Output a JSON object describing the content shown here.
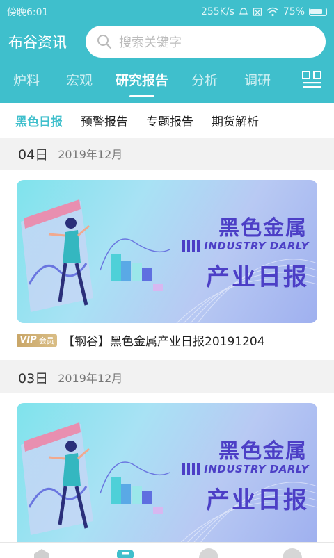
{
  "status_bar": {
    "time": "傍晚6:01",
    "net_speed": "255K/s",
    "battery": "75%"
  },
  "header": {
    "app_title": "布谷资讯",
    "search_placeholder": "搜索关键字"
  },
  "channel_tabs": [
    {
      "label": "炉料",
      "active": false
    },
    {
      "label": "宏观",
      "active": false
    },
    {
      "label": "研究报告",
      "active": true
    },
    {
      "label": "分析",
      "active": false
    },
    {
      "label": "调研",
      "active": false
    }
  ],
  "sub_tabs": [
    {
      "label": "黑色日报",
      "active": true
    },
    {
      "label": "预警报告",
      "active": false
    },
    {
      "label": "专题报告",
      "active": false
    },
    {
      "label": "期货解析",
      "active": false
    }
  ],
  "feed": [
    {
      "day": "04日",
      "month": "2019年12月",
      "banner": {
        "title": "黑色金属",
        "english": "INDUSTRY DARLY",
        "subtitle": "产业日报"
      },
      "vip_badge": {
        "vip": "VIP",
        "member": "会员"
      },
      "article_title": "【钢谷】黑色金属产业日报20191204"
    },
    {
      "day": "03日",
      "month": "2019年12月",
      "banner": {
        "title": "黑色金属",
        "english": "INDUSTRY DARLY",
        "subtitle": "产业日报"
      }
    }
  ],
  "colors": {
    "accent": "#3fbfcc",
    "banner_text": "#4c3fc6",
    "vip_gold": "#c9a668"
  }
}
